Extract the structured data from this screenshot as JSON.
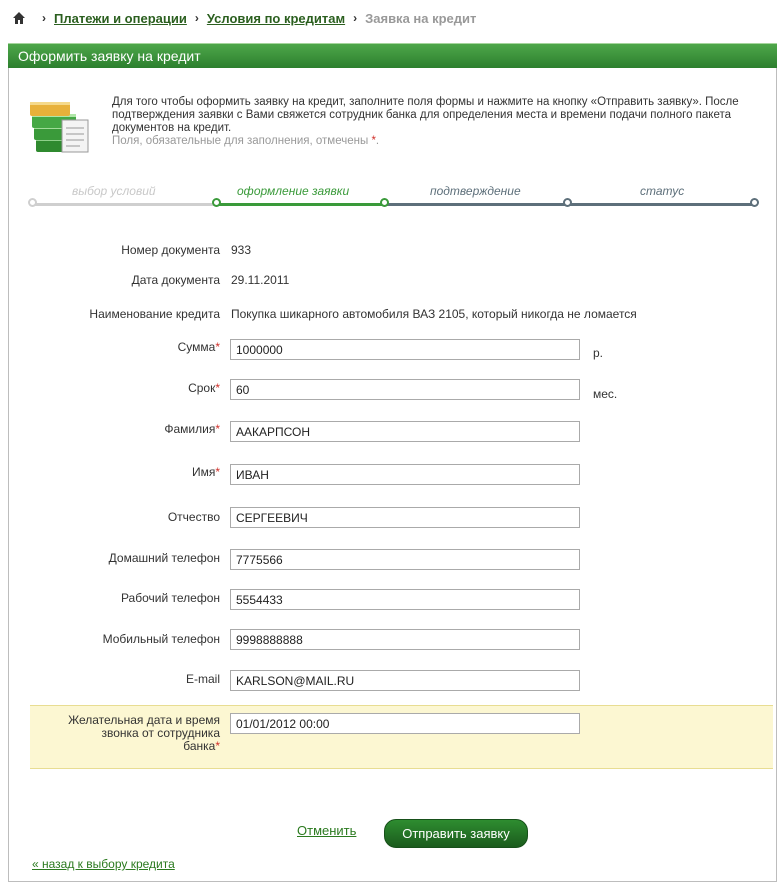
{
  "breadcrumb": {
    "items": [
      "Платежи и операции",
      "Условия по кредитам"
    ],
    "current": "Заявка на кредит",
    "separator": "›"
  },
  "panel": {
    "title": "Оформить заявку на кредит"
  },
  "intro": {
    "text": "Для того чтобы оформить заявку на кредит, заполните поля формы и нажмите на кнопку «Отправить заявку». После подтверждения заявки с Вами свяжется сотрудник банка для определения места и времени подачи полного пакета документов на кредит.",
    "note": "Поля, обязательные для заполнения, отмечены",
    "note_mark": "*",
    "note_end": "."
  },
  "steps": [
    {
      "label": "выбор условий",
      "state": "done"
    },
    {
      "label": "оформление заявки",
      "state": "active"
    },
    {
      "label": "подтверждение",
      "state": "pending"
    },
    {
      "label": "статус",
      "state": "pending"
    }
  ],
  "info": {
    "doc_number_label": "Номер документа",
    "doc_number": "933",
    "doc_date_label": "Дата документа",
    "doc_date": "29.11.2011",
    "credit_name_label": "Наименование кредита",
    "credit_name": "Покупка шикарного автомобиля ВАЗ 2105, который никогда не ломается"
  },
  "form": {
    "required_mark": "*",
    "sum": {
      "label": "Сумма",
      "value": "1000000",
      "unit": "р."
    },
    "term": {
      "label": "Срок",
      "value": "60",
      "unit": "мес."
    },
    "surname": {
      "label": "Фамилия",
      "value": "ААКАРПСОН"
    },
    "name": {
      "label": "Имя",
      "value": "ИВАН"
    },
    "patronymic": {
      "label": "Отчество",
      "value": "СЕРГЕЕВИЧ"
    },
    "home_phone": {
      "label": "Домашний телефон",
      "value": "7775566"
    },
    "work_phone": {
      "label": "Рабочий телефон",
      "value": "5554433"
    },
    "mobile_phone": {
      "label": "Мобильный телефон",
      "value": "9998888888"
    },
    "email": {
      "label": "E-mail",
      "value": "KARLSON@MAIL.RU"
    },
    "call_time": {
      "label_line1": "Желательная дата и время",
      "label_line2": "звонка от сотрудника",
      "label_line3": "банка",
      "value": "01/01/2012 00:00"
    }
  },
  "actions": {
    "cancel": "Отменить",
    "submit": "Отправить заявку",
    "back": "« назад к выбору кредита"
  },
  "colors": {
    "header_green": "#2c7f2e",
    "step_done": "#cfcfcf",
    "step_active": "#3a9a3a",
    "step_pending": "#5d6f7a",
    "required": "#d0302a",
    "highlight": "#fcf7d2"
  }
}
